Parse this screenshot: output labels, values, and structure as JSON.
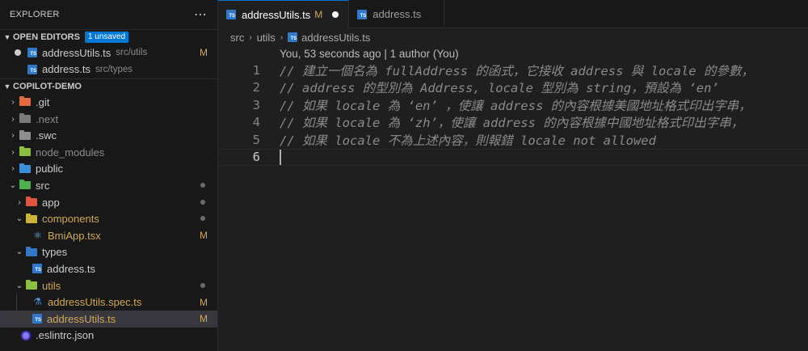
{
  "sidebar": {
    "title": "EXPLORER",
    "more_icon": "⋯",
    "open_editors": {
      "title": "OPEN EDITORS",
      "badge": "1 unsaved",
      "items": [
        {
          "name": "addressUtils.ts",
          "path": "src/utils",
          "status": "M"
        },
        {
          "name": "address.ts",
          "path": "src/types"
        }
      ]
    },
    "project": {
      "title": "COPILOT-DEMO",
      "items": [
        {
          "name": ".git"
        },
        {
          "name": ".next"
        },
        {
          "name": ".swc"
        },
        {
          "name": "node_modules"
        },
        {
          "name": "public"
        },
        {
          "name": "src"
        },
        {
          "name": "app"
        },
        {
          "name": "components"
        },
        {
          "name": "BmiApp.tsx",
          "status": "M"
        },
        {
          "name": "types"
        },
        {
          "name": "address.ts"
        },
        {
          "name": "utils"
        },
        {
          "name": "addressUtils.spec.ts",
          "status": "M"
        },
        {
          "name": "addressUtils.ts",
          "status": "M"
        },
        {
          "name": ".eslintrc.json"
        }
      ]
    }
  },
  "tabs": [
    {
      "label": "addressUtils.ts",
      "status": "M"
    },
    {
      "label": "address.ts"
    }
  ],
  "breadcrumb": [
    "src",
    "utils",
    "addressUtils.ts"
  ],
  "blame": "You, 53 seconds ago | 1 author (You)",
  "code": [
    {
      "n": "1",
      "text": "// 建立一個名為 fullAddress 的函式，它接收 address 與 locale 的參數，"
    },
    {
      "n": "2",
      "text": "// address 的型別為 Address, locale 型別為 string，預設為 ‘en’"
    },
    {
      "n": "3",
      "text": "// 如果 locale 為 ‘en’ ，使讓 address 的內容根據美國地址格式印出字串，"
    },
    {
      "n": "4",
      "text": "// 如果 locale 為 ‘zh’，使讓 address 的內容根據中國地址格式印出字串，"
    },
    {
      "n": "5",
      "text": "// 如果 locale 不為上述內容，則報錯 locale not allowed"
    },
    {
      "n": "6",
      "text": ""
    }
  ],
  "icon_ts": "TS",
  "colors": {
    "accent": "#0078d4",
    "modified": "#cfa95b",
    "ts": "#3178c6"
  }
}
